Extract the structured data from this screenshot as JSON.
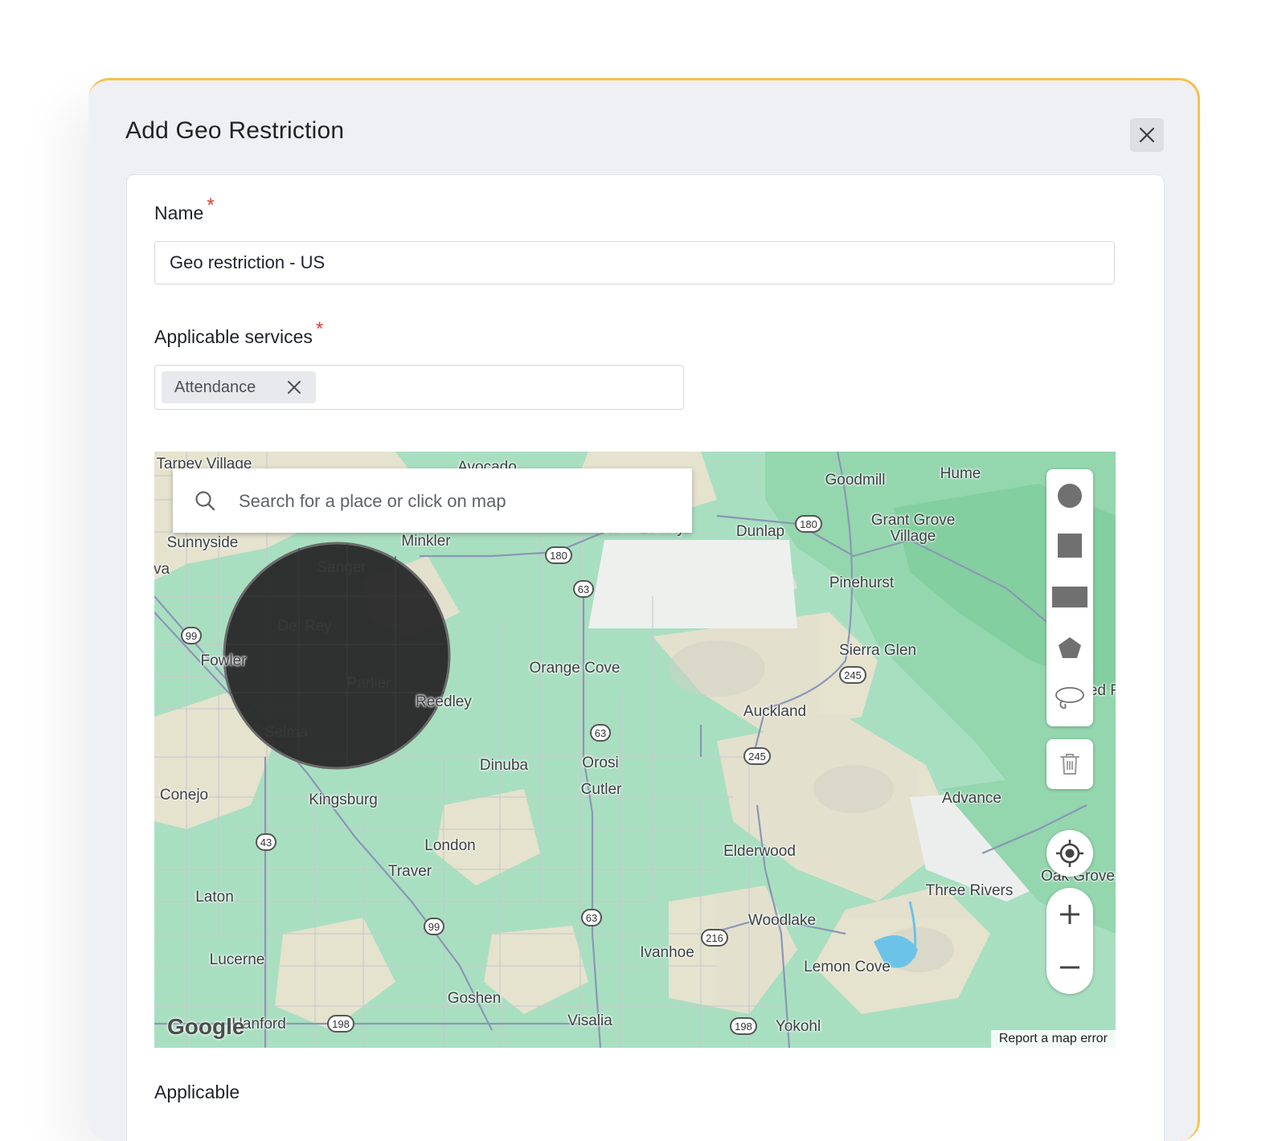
{
  "dialog": {
    "title": "Add Geo Restriction",
    "accent_color": "#f7c04d"
  },
  "form": {
    "name_label": "Name",
    "name_value": "Geo restriction - US",
    "required_mark": "*",
    "services_label": "Applicable services",
    "services": [
      {
        "label": "Attendance"
      }
    ],
    "next_label_partial": "Applicable"
  },
  "map": {
    "search_placeholder": "Search for a place or click on map",
    "places": [
      "Tarpey Village",
      "Avocado",
      "Goodmill",
      "Hume",
      "Sunnyside",
      "Minkler",
      "Tokata Valley",
      "Dunlap",
      "Grant Grove",
      "Village",
      "va",
      "Sanger",
      "Pinehurst",
      "Del Rey",
      "Fowler",
      "Orange Cove",
      "Sierra Glen",
      "Parlier",
      "Reedley",
      "Red F",
      "Auckland",
      "Selma",
      "Dinuba",
      "Orosi",
      "Cutler",
      "Conejo",
      "Kingsburg",
      "Advance",
      "London",
      "Elderwood",
      "Traver",
      "Oak Grove",
      "Laton",
      "Three Rivers",
      "Woodlake",
      "Ivanhoe",
      "Lucerne",
      "Lemon Cove",
      "Goshen",
      "Hanford",
      "Visalia",
      "Yokohl"
    ],
    "route_shields": [
      "180",
      "180",
      "63",
      "99",
      "245",
      "63",
      "245",
      "43",
      "99",
      "63",
      "216",
      "198",
      "198"
    ],
    "drawing_tools": [
      "circle-tool-icon",
      "square-tool-icon",
      "rectangle-tool-icon",
      "polygon-tool-icon",
      "lasso-tool-icon"
    ],
    "attribution": "Google",
    "report_link": "Report a map error",
    "colors": {
      "land_green": "#a9dfc1",
      "land_tan": "#e8e1cf",
      "forest": "#94d6ae",
      "water": "#6cc3e8",
      "circle_fill": "#2b2b2b"
    }
  }
}
